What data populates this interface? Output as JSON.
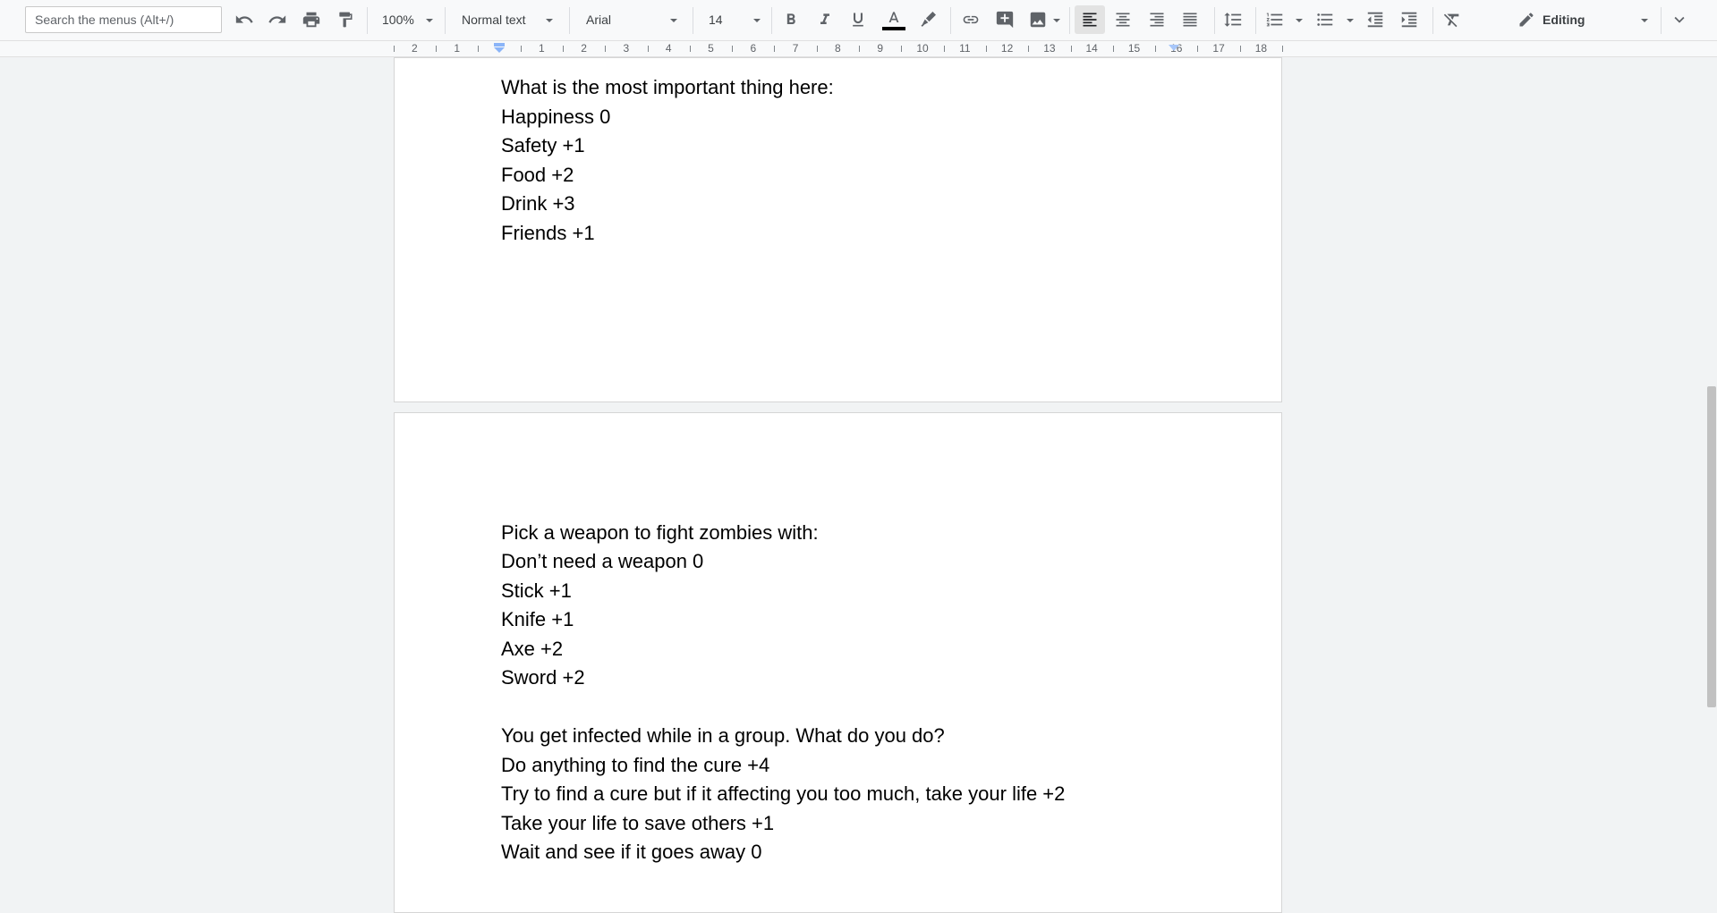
{
  "toolbar": {
    "search_placeholder": "Search the menus (Alt+/)",
    "zoom": "100%",
    "style": "Normal text",
    "font": "Arial",
    "font_size": "14",
    "mode": "Editing"
  },
  "ruler": {
    "labels": [
      "2",
      "1",
      "1",
      "2",
      "3",
      "4",
      "5",
      "6",
      "7",
      "8",
      "9",
      "10",
      "11",
      "12",
      "13",
      "14",
      "15",
      "16",
      "17",
      "18"
    ]
  },
  "document": {
    "page1_lines": [
      "What is the most important thing here:",
      "Happiness 0",
      "Safety +1",
      "Food +2",
      "Drink +3",
      "Friends +1"
    ],
    "page2_block1": [
      "Pick a weapon to fight zombies with:",
      "Don’t need a weapon 0",
      "Stick +1",
      "Knife +1",
      "Axe +2",
      "Sword +2"
    ],
    "page2_block2": [
      "You get infected while in a group. What do you do?",
      "Do anything to find the cure +4",
      "Try to find a cure but if it affecting you too much, take your life +2",
      "Take your life to save others +1",
      "Wait and see if it goes away 0"
    ]
  },
  "colors": {
    "text_color_bar": "#000000",
    "active_bg": "#e3e3e3"
  }
}
